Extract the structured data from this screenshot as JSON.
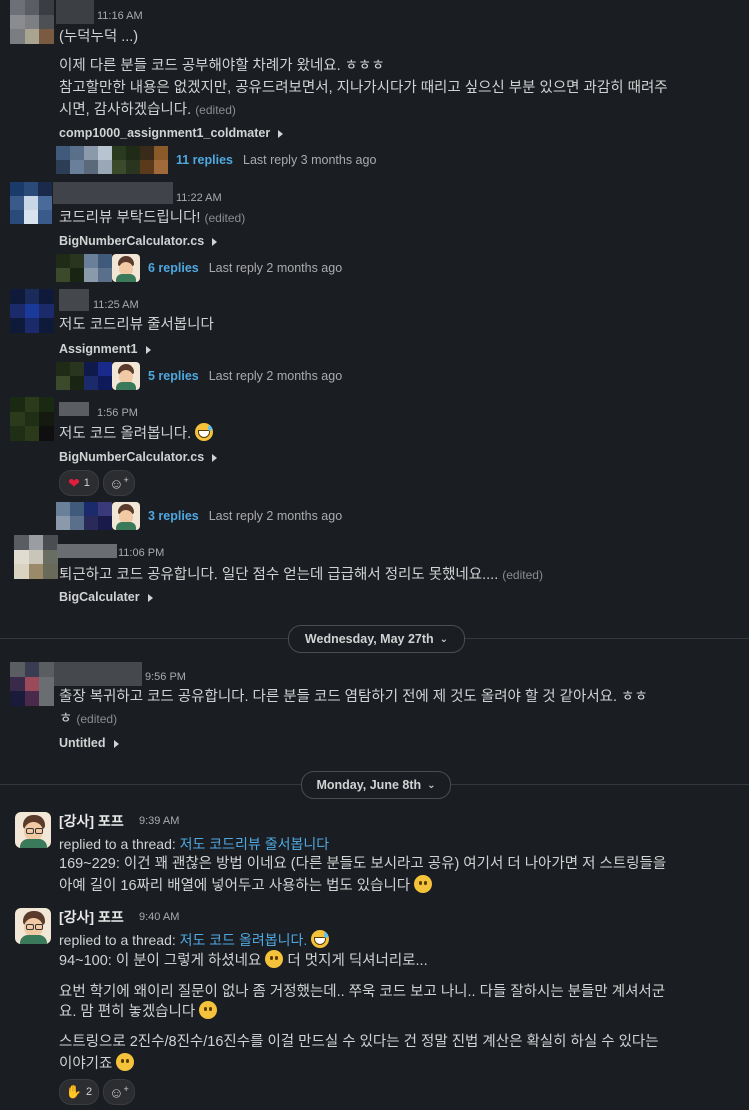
{
  "messages": [
    {
      "time": "11:16 AM",
      "pre_text": "(누덕누덕 ...)",
      "lines": [
        "이제 다른 분들 코드 공부해야할 차례가 왔네요. ㅎㅎㅎ",
        "참고할만한 내용은 없겠지만, 공유드려보면서, 지나가시다가 때리고 싶으신 부분 있으면 과감히 때려주",
        "시면, 감사하겠습니다."
      ],
      "edited": "(edited)",
      "snippet": "comp1000_assignment1_coldmater",
      "reply_count": "11 replies",
      "last_reply": "Last reply 3 months ago"
    },
    {
      "time": "11:22 AM",
      "text": "코드리뷰 부탁드립니다!",
      "edited": "(edited)",
      "snippet": "BigNumberCalculator.cs",
      "reply_count": "6 replies",
      "last_reply": "Last reply 2 months ago"
    },
    {
      "time": "11:25 AM",
      "text": "저도 코드리뷰 줄서봅니다",
      "snippet": "Assignment1",
      "reply_count": "5 replies",
      "last_reply": "Last reply 2 months ago"
    },
    {
      "time": "1:56 PM",
      "text": "저도 코드 올려봅니다.",
      "snippet": "BigNumberCalculator.cs",
      "reaction_count": "1",
      "reply_count": "3 replies",
      "last_reply": "Last reply 2 months ago"
    },
    {
      "time": "11:06 PM",
      "text": "퇴근하고 코드 공유합니다. 일단 점수 얻는데 급급해서 정리도 못했네요....",
      "edited": "(edited)",
      "snippet": "BigCalculater"
    }
  ],
  "day_dividers": [
    "Wednesday, May 27th",
    "Monday, June 8th"
  ],
  "may27": {
    "time": "9:56 PM",
    "lines": [
      "출장 복귀하고 코드 공유합니다. 다른 분들 코드 염탐하기 전에 제 것도 올려야 할 것 같아서요. ㅎㅎ",
      "ㅎ"
    ],
    "edited": "(edited)",
    "snippet": "Untitled"
  },
  "june8": [
    {
      "author": "[강사] 포프",
      "time": "9:39 AM",
      "replied_prefix": "replied to a thread:",
      "thread_title": "저도 코드리뷰 줄서봅니다",
      "lines": [
        "169~229: 이건 꽤 괜찮은 방법 이네요 (다른 분들도 보시라고 공유) 여기서 더 나아가면 저 스트링들을",
        "아예 길이 16짜리 배열에 넣어두고 사용하는 법도 있습니다"
      ]
    },
    {
      "author": "[강사] 포프",
      "time": "9:40 AM",
      "replied_prefix": "replied to a thread:",
      "thread_title": "저도 코드 올려봅니다.",
      "line1_a": "94~100: 이 분이 그렇게 하셨네요",
      "line1_b": "더 멋지게 딕셔너리로...",
      "para2": [
        "요번 학기에 왜이리 질문이 없나 좀 거정했는데.. 쭈욱 코드 보고 나니.. 다들 잘하시는 분들만 계셔서군",
        "요. 맘 편히 놓겠습니다"
      ],
      "para3": [
        "스트링으로 2진수/8진수/16진수를 이걸 만드실 수 있다는 건 정말 진법 계산은 확실히 하실 수 있다는",
        "이야기죠"
      ],
      "reaction_count": "2"
    }
  ]
}
